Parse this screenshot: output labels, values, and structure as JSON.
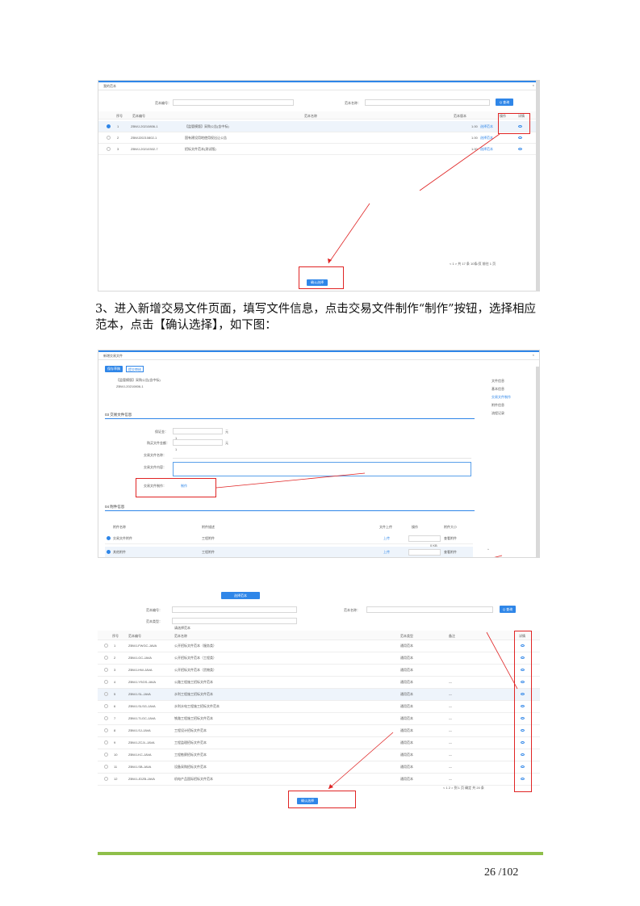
{
  "paragraph": "3、进入新增交易文件页面，填写文件信息，点击交易文件制作“制作”按钮，选择相应范本，点击【确认选择】，如下图：",
  "page_number": "26 /102",
  "shot1": {
    "dialog_title": "我的范本",
    "filter_label_1": "范本编号：",
    "filter_label_2": "范本名称：",
    "search_button": "Q 查询",
    "columns": [
      "序号",
      "范本编号",
      "范本名称",
      "范本版本",
      "操作",
      "详情"
    ],
    "rows": [
      {
        "no": "1",
        "code": "ZBWJ-20210806-1",
        "name": "【监管模版】采购公告(含中标)",
        "ver": "1.00",
        "op": "选择范本",
        "selected": true
      },
      {
        "no": "2",
        "code": "ZBWJ20210802-1",
        "name": "国有建设用地使用权出让公告",
        "ver": "1.00",
        "op": "选择范本",
        "selected": false
      },
      {
        "no": "3",
        "code": "ZBWJ-20210302-7",
        "name": "招标文件范本(测试版)",
        "ver": "1.00",
        "op": "选择范本",
        "selected": false
      }
    ],
    "pagination": "< 1 > 共 17 条 10条/页 前往 1 页",
    "confirm_button": "确认选择"
  },
  "shot2": {
    "dialog_title": "新增交易文件",
    "tab_1": "保存草稿",
    "tab_2": "提交审核",
    "project_name": "【监管模版】采购公告(含中标)",
    "project_code": "ZBWJ-20210806-1",
    "right_nav": [
      "文件信息",
      "基本信息",
      "交易文件制作",
      "附件信息",
      "流程记录"
    ],
    "section_1": "03 交易文件信息",
    "field_1_label": "保证金：",
    "field_1_value": "1",
    "field_1_unit": "元",
    "field_2_label": "购买文件金额：",
    "field_2_value": "1",
    "field_2_unit": "元",
    "field_3_label": "交易文件名称：",
    "field_4_label": "交易文件内容：",
    "make_label": "交易文件制作：",
    "make_button": "制作",
    "section_2": "04 附件信息",
    "att_columns": [
      "附件名称",
      "附件描述",
      "文件上传",
      "操作",
      "附件大小"
    ],
    "att_rows": [
      {
        "name": "交易文件附件",
        "desc": "工程附件",
        "upload": "上传",
        "size": "0 KB",
        "op": "查看附件"
      },
      {
        "name": "其他附件",
        "desc": "工程附件",
        "upload": "上传",
        "size": "0 KB",
        "op": "查看附件"
      }
    ]
  },
  "shot3": {
    "top_button": "选择范本",
    "filter_label_1": "范本编号：",
    "filter_label_2": "范本名称：",
    "filter_label_3": "范本类型：",
    "type_value": "请选择范本",
    "search_button": "Q 查询",
    "columns": [
      "序号",
      "范本编号",
      "范本名称",
      "范本类型",
      "备注",
      "详情"
    ],
    "rows": [
      {
        "no": "1",
        "code": "ZBWJ-FWGC-JAVA",
        "name": "公开招标文件范本（服务类）",
        "type": "通用范本",
        "remark": ""
      },
      {
        "no": "2",
        "code": "ZBWJ-GC-JAVA",
        "name": "公开招标文件范本（工程类）",
        "type": "通用范本",
        "remark": ""
      },
      {
        "no": "3",
        "code": "ZBWJ-HW-JAVA",
        "name": "公开招标文件范本（货物类）",
        "type": "通用范本",
        "remark": ""
      },
      {
        "no": "4",
        "code": "ZBWJ-YSGS-JAVA",
        "name": "公路工程施工招标文件范本",
        "type": "通用范本",
        "remark": "—"
      },
      {
        "no": "5",
        "code": "ZBWJ-SL-JAVA",
        "name": "水利工程施工招标文件范本",
        "type": "通用范本",
        "remark": "—"
      },
      {
        "no": "6",
        "code": "ZBWJ-SLSG-JAVA",
        "name": "水利水电工程施工招标文件范本",
        "type": "通用范本",
        "remark": "—"
      },
      {
        "no": "7",
        "code": "ZBWJ-TLGC-JAVA",
        "name": "铁路工程施工招标文件范本",
        "type": "通用范本",
        "remark": "—"
      },
      {
        "no": "8",
        "code": "ZBWJ-SJ-JAVA",
        "name": "工程设计招标文件范本",
        "type": "通用范本",
        "remark": "—"
      },
      {
        "no": "9",
        "code": "ZBWJ-ZCJL-JAVA",
        "name": "工程监理招标文件范本",
        "type": "通用范本",
        "remark": "—"
      },
      {
        "no": "10",
        "code": "ZBWJ-KC-JAVA",
        "name": "工程勘察招标文件范本",
        "type": "通用范本",
        "remark": "—"
      },
      {
        "no": "11",
        "code": "ZBWJ-SB-JAVA",
        "name": "设备采购招标文件范本",
        "type": "通用范本",
        "remark": "—"
      },
      {
        "no": "12",
        "code": "ZBWJ-JDZB-JAVA",
        "name": "机电产品国际招标文件范本",
        "type": "通用范本",
        "remark": "—"
      }
    ],
    "pagination": "< 1 2 > 到 1 页 确定 共 20 条",
    "confirm_button": "确认选择"
  }
}
